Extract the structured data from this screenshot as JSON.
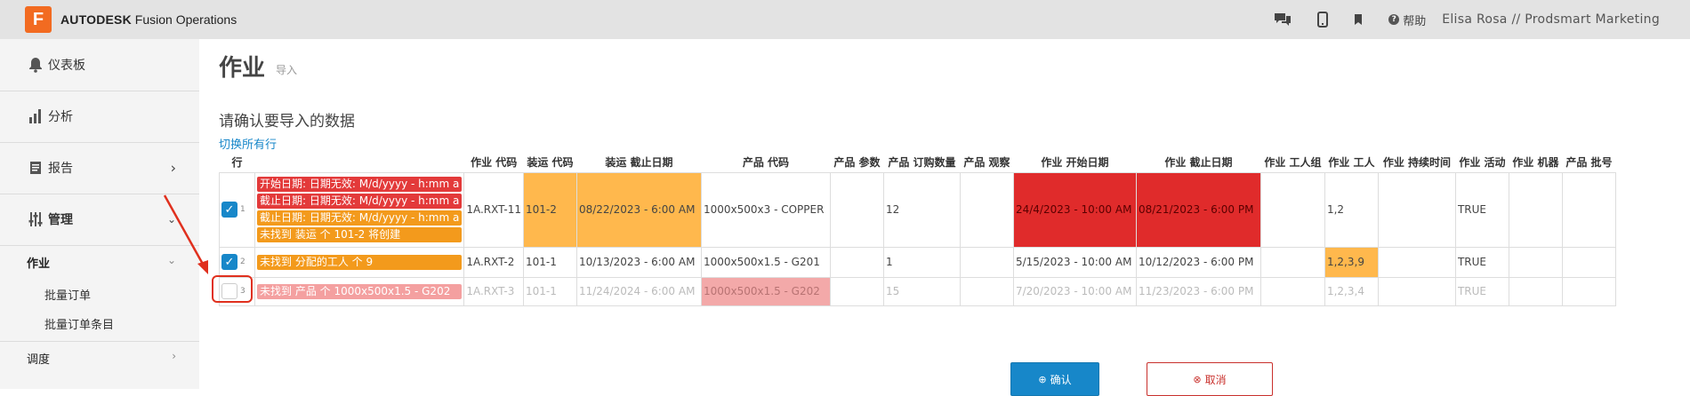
{
  "header": {
    "logo_letter": "F",
    "brand_bold": "AUTODESK",
    "brand_rest": "Fusion Operations",
    "help_label": "帮助",
    "user_label": "Elisa Rosa // Prodsmart Marketing",
    "icons": [
      "chat-icon",
      "mobile-icon",
      "bookmark-icon",
      "help-icon"
    ]
  },
  "sidebar": {
    "items": [
      {
        "label": "仪表板",
        "icon": "bell-icon"
      },
      {
        "label": "分析",
        "icon": "bar-chart-icon"
      },
      {
        "label": "报告",
        "icon": "report-icon"
      },
      {
        "label": "管理",
        "icon": "sliders-icon"
      }
    ],
    "section": "作业",
    "subitems": [
      "批量订单",
      "批量订单条目"
    ],
    "next_section": "调度"
  },
  "page": {
    "title": "作业",
    "subtitle": "导入",
    "confirm_heading": "请确认要导入的数据",
    "toggle_rows": "切换所有行"
  },
  "table": {
    "columns": [
      "行",
      "",
      "作业 代码",
      "装运 代码",
      "装运 截止日期",
      "产品 代码",
      "产品 参数",
      "产品 订购数量",
      "产品 观察",
      "作业 开始日期",
      "作业 截止日期",
      "作业 工人组",
      "作业 工人",
      "作业 持续时间",
      "作业 活动",
      "作业 机器",
      "产品 批号"
    ],
    "rows": [
      {
        "num": "1",
        "checked": true,
        "messages": [
          {
            "text": "开始日期: 日期无效: M/d/yyyy - h:mm a",
            "color": "red"
          },
          {
            "text": "截止日期: 日期无效: M/d/yyyy - h:mm a",
            "color": "red"
          },
          {
            "text": "截止日期: 日期无效: M/d/yyyy - h:mm a",
            "color": "orange"
          },
          {
            "text": "未找到 装运 个 101-2 将创建",
            "color": "orange"
          }
        ],
        "job_code": "1A.RXT-11",
        "ship_code": "101-2",
        "ship_due": "08/22/2023 - 6:00 AM",
        "product_code": "1000x500x3 - COPPER",
        "product_param": "",
        "qty": "12",
        "obs": "",
        "start": "24/4/2023 - 10:00 AM",
        "due": "08/21/2023 - 6:00 PM",
        "group": "",
        "workers": "1,2",
        "duration": "",
        "active": "TRUE",
        "machine": "",
        "batch": ""
      },
      {
        "num": "2",
        "checked": true,
        "messages": [
          {
            "text": "未找到 分配的工人 个 9",
            "color": "orange"
          }
        ],
        "job_code": "1A.RXT-2",
        "ship_code": "101-1",
        "ship_due": "10/13/2023 - 6:00 AM",
        "product_code": "1000x500x1.5 - G201",
        "product_param": "",
        "qty": "1",
        "obs": "",
        "start": "5/15/2023 - 10:00 AM",
        "due": "10/12/2023 - 6:00 PM",
        "group": "",
        "workers": "1,2,3,9",
        "duration": "",
        "active": "TRUE",
        "machine": "",
        "batch": ""
      },
      {
        "num": "3",
        "checked": false,
        "messages": [
          {
            "text": "未找到 产品 个 1000x500x1.5 - G202",
            "color": "pink"
          }
        ],
        "job_code": "1A.RXT-3",
        "ship_code": "101-1",
        "ship_due": "11/24/2024 - 6:00 AM",
        "product_code": "1000x500x1.5 - G202",
        "product_param": "",
        "qty": "15",
        "obs": "",
        "start": "7/20/2023 - 10:00 AM",
        "due": "11/23/2023 - 6:00 PM",
        "group": "",
        "workers": "1,2,3,4",
        "duration": "",
        "active": "TRUE",
        "machine": "",
        "batch": ""
      }
    ]
  },
  "actions": {
    "confirm_label": "确认",
    "cancel_label": "取消"
  },
  "colors": {
    "accent": "#1787c9",
    "error": "#e02b2b",
    "warning": "#ffb84d",
    "logo": "#f26b21"
  }
}
